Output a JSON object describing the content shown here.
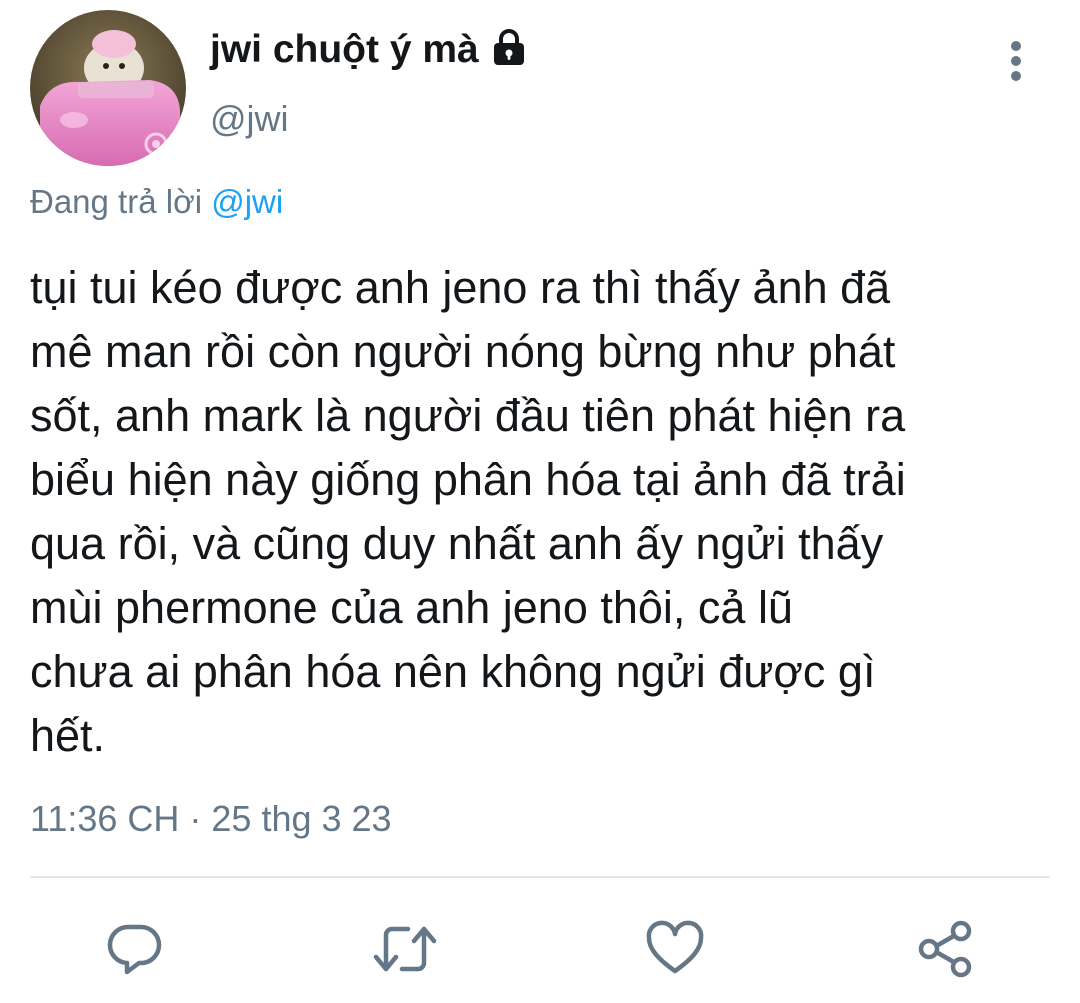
{
  "tweet": {
    "display_name": "jwi chuột ý mà",
    "handle": "@jwi",
    "reply_prefix": "Đang trả lời",
    "reply_to": "@jwi",
    "text": "tụi tui kéo được anh jeno ra thì thấy ảnh đã\nmê man rồi còn người nóng bừng như phát\nsốt, anh mark là người đầu tiên phát hiện ra\nbiểu hiện này giống phân hóa tại ảnh đã trải\nqua rồi, và cũng duy nhất anh ấy ngửi thấy\nmùi phermone của anh jeno thôi, cả lũ\nchưa ai phân hóa nên không ngửi được gì\nhết.",
    "timestamp": "11:36 CH · 25 thg 3 23"
  },
  "icons": {
    "lock": "lock-icon",
    "more": "more-vertical-icon",
    "reply": "reply-icon",
    "retweet": "retweet-icon",
    "like": "heart-icon",
    "share": "share-icon"
  },
  "colors": {
    "text": "#14171a",
    "secondary": "#657786",
    "mention": "#1da1f2",
    "divider": "#e1e8ed"
  }
}
